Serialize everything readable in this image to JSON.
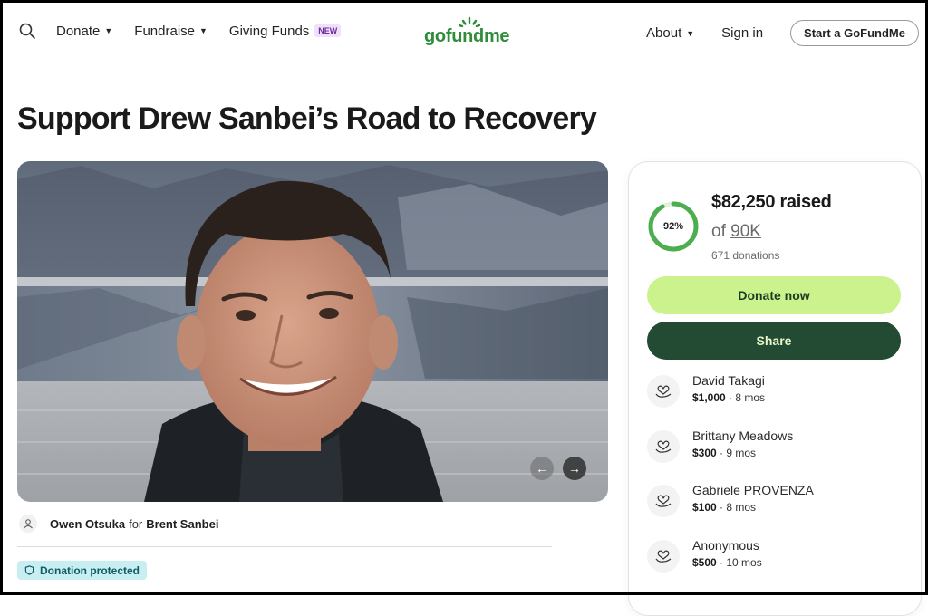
{
  "nav": {
    "donate": "Donate",
    "fundraise": "Fundraise",
    "giving_funds": "Giving Funds",
    "new_badge": "NEW",
    "logo": "gofundme",
    "about": "About",
    "sign_in": "Sign in",
    "start": "Start a GoFundMe"
  },
  "campaign": {
    "title": "Support Drew Sanbei’s Road to Recovery",
    "organizer": "Owen Otsuka",
    "for_word": "for",
    "beneficiary": "Brent Sanbei",
    "protected_label": "Donation protected"
  },
  "progress": {
    "percent_label": "92%",
    "fraction": 0.92,
    "raised": "$82,250 raised",
    "of_word": "of",
    "goal": "90K",
    "donations": "671 donations"
  },
  "actions": {
    "donate": "Donate now",
    "share": "Share"
  },
  "donors": [
    {
      "name": "David Takagi",
      "amount": "$1,000",
      "time": "· 8 mos"
    },
    {
      "name": "Brittany Meadows",
      "amount": "$300",
      "time": "· 9 mos"
    },
    {
      "name": "Gabriele PROVENZA",
      "amount": "$100",
      "time": "· 8 mos"
    },
    {
      "name": "Anonymous",
      "amount": "$500",
      "time": "· 10 mos"
    }
  ],
  "colors": {
    "brand_green": "#2f8d3a",
    "donate_bg": "#cbf28d",
    "share_bg": "#234a32",
    "protected_bg": "#c8eef2"
  },
  "icons": [
    "search-icon",
    "caret-down-icon",
    "user-icon",
    "shield-icon",
    "heart-hand-icon",
    "arrow-left-icon",
    "arrow-right-icon"
  ]
}
